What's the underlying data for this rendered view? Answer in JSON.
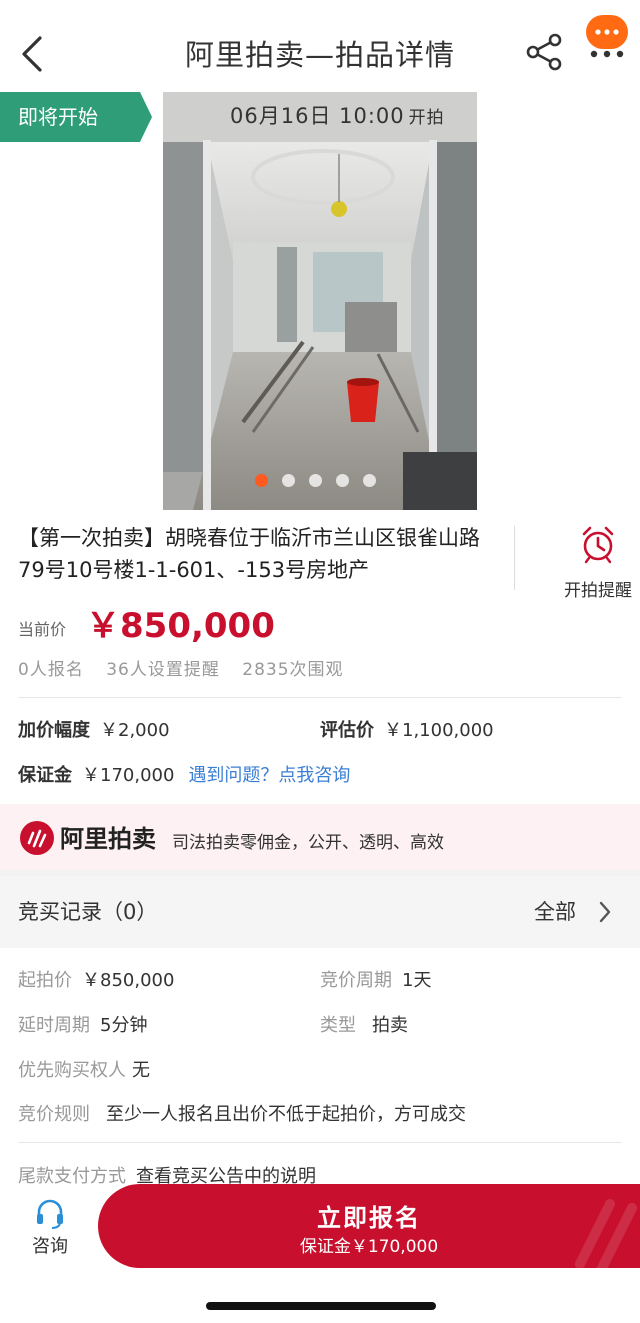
{
  "header": {
    "title": "阿里拍卖—拍品详情"
  },
  "gallery": {
    "status_tag": "即将开始",
    "start_time": "06月16日 10:00",
    "start_suffix": "开拍",
    "slide_count": 5,
    "active_slide": 1
  },
  "lot": {
    "title": "【第一次拍卖】胡晓春位于临沂市兰山区银雀山路79号10号楼1-1-601、-153号房地产",
    "reminder_label": "开拍提醒",
    "current_price_label": "当前价",
    "current_price": "￥850,000",
    "signups": "0人报名",
    "reminders": "36人设置提醒",
    "views": "2835次围观"
  },
  "info": {
    "increment_label": "加价幅度",
    "increment_value": "￥2,000",
    "appraisal_label": "评估价",
    "appraisal_value": "￥1,100,000",
    "deposit_label": "保证金",
    "deposit_value": "￥170,000",
    "consult_link": "遇到问题？点我咨询"
  },
  "brand": {
    "name": "阿里拍卖",
    "slogan": "司法拍卖零佣金，公开、透明、高效"
  },
  "bid_record": {
    "label": "竞买记录（0）",
    "all_label": "全部"
  },
  "details": {
    "start_price_label": "起拍价",
    "start_price_value": "￥850,000",
    "bid_cycle_label": "竞价周期",
    "bid_cycle_value": "1天",
    "delay_label": "延时周期",
    "delay_value": "5分钟",
    "type_label": "类型",
    "type_value": "拍卖",
    "priority_label": "优先购买权人",
    "priority_value": "无",
    "rule_label": "竞价规则",
    "rule_value": "至少一人报名且出价不低于起拍价，方可成交",
    "payment_label": "尾款支付方式",
    "payment_value": "查看竞买公告中的说明"
  },
  "bottom_bar": {
    "consult_label": "咨询",
    "signup_label": "立即报名",
    "signup_sub": "保证金￥170,000"
  },
  "colors": {
    "accent_red": "#c8102e",
    "status_green": "#2f9e78",
    "link_blue": "#3a7fd5",
    "badge_orange": "#ff6a13"
  }
}
